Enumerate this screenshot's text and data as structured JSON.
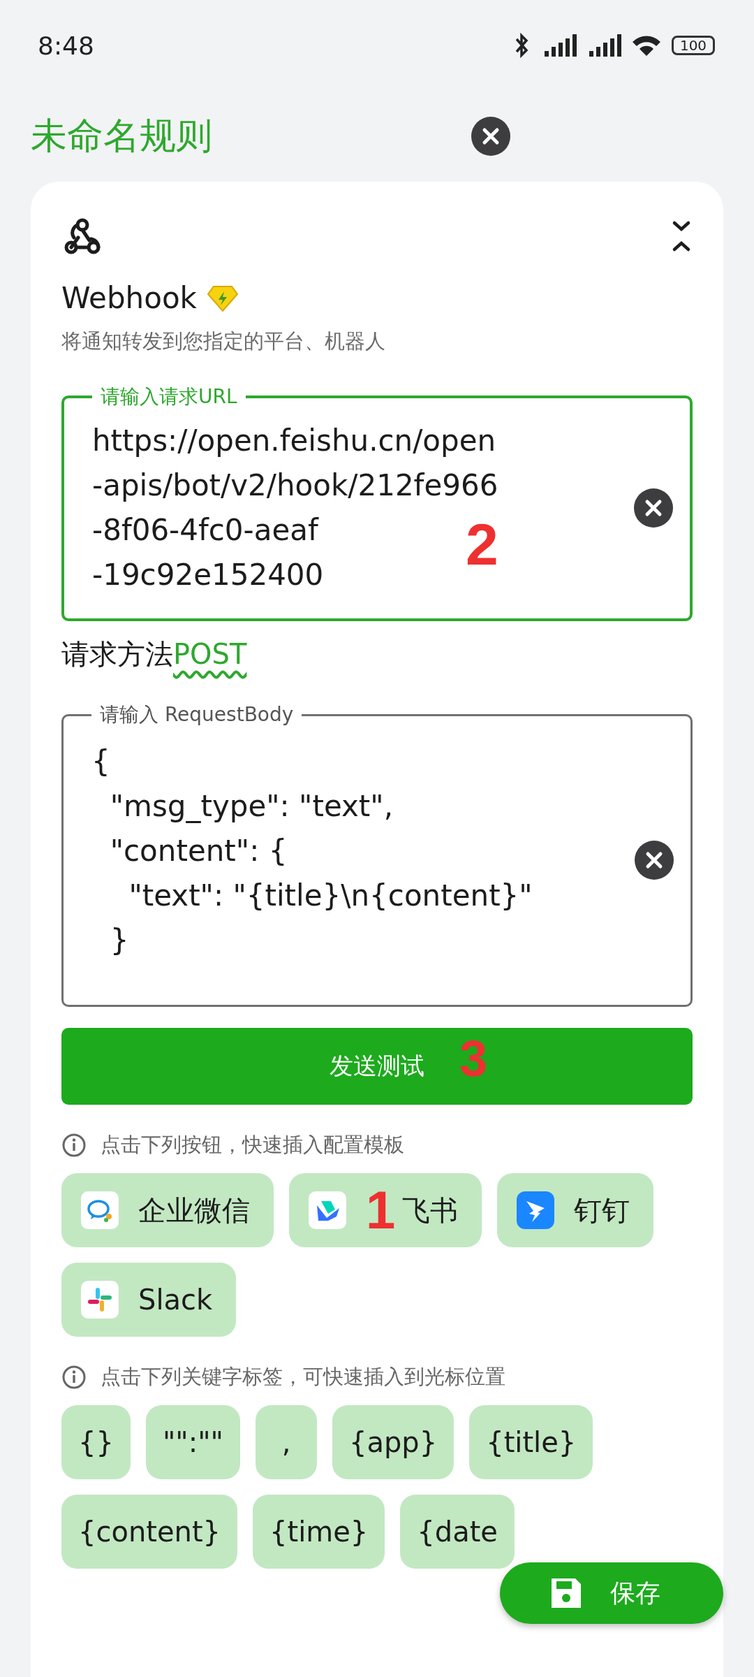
{
  "status_bar": {
    "time": "8:48",
    "battery": "100"
  },
  "header": {
    "title": "未命名规则"
  },
  "card": {
    "name": "Webhook",
    "subtitle": "将通知转发到您指定的平台、机器人"
  },
  "url_field": {
    "label": "请输入请求URL",
    "value": "https://open.feishu.cn/open-apis/bot/v2/hook/212fe966-8f06-4fc0-aeaf-19c92e152400",
    "focused": true,
    "annotation": "2"
  },
  "method": {
    "label": "请求方法",
    "value": "POST"
  },
  "body_field": {
    "label": "请输入 RequestBody",
    "value": "{\n  \"msg_type\": \"text\",\n  \"content\": {\n    \"text\": \"{title}\\n{content}\"\n  }",
    "focused": false
  },
  "send_button": {
    "label": "发送测试",
    "annotation": "3"
  },
  "templates": {
    "hint": "点击下列按钮，快速插入配置模板",
    "items": [
      {
        "label": "企业微信",
        "kind": "wecom"
      },
      {
        "label": "飞书",
        "kind": "feishu",
        "annotation": "1"
      },
      {
        "label": "钉钉",
        "kind": "dingtalk"
      },
      {
        "label": "Slack",
        "kind": "slack"
      }
    ]
  },
  "keywords": {
    "hint": "点击下列关键字标签，可快速插入到光标位置",
    "items": [
      "{}",
      "\"\":\"\"",
      ",",
      "{app}",
      "{title}",
      "{content}",
      "{time}",
      "{date"
    ]
  },
  "save_button": {
    "label": "保存"
  }
}
